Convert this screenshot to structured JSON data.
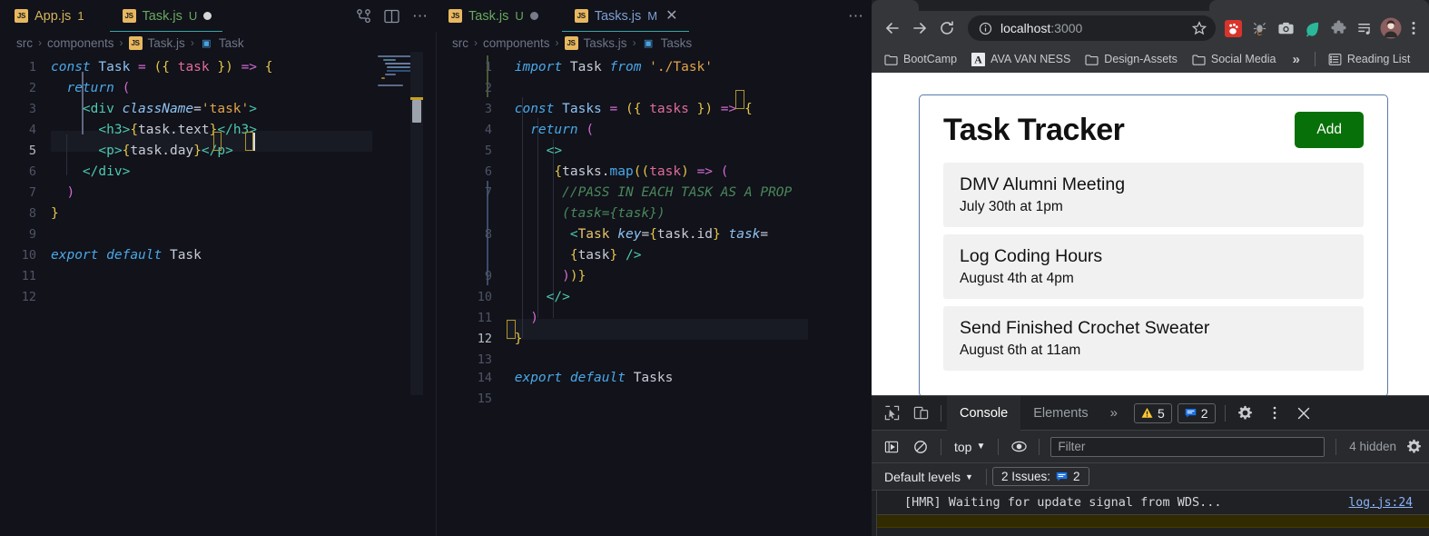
{
  "editor": {
    "pane_a": {
      "tabs": [
        {
          "label": "App.js",
          "icon": "js-file-icon",
          "badge": "1",
          "state": "",
          "active": false
        },
        {
          "label": "Task.js",
          "icon": "js-file-icon",
          "badge": "U",
          "state": "unsaved-dot",
          "active": true
        }
      ],
      "actions": [
        "source-control-icon",
        "split-editor-icon",
        "more-actions-icon"
      ],
      "breadcrumb": [
        "src",
        "components",
        "Task.js",
        "Task"
      ],
      "lines": [
        {
          "n": "1",
          "text": "const Task = ({ task }) => {"
        },
        {
          "n": "2",
          "text": "  return ("
        },
        {
          "n": "3",
          "text": "    <div className='task'>"
        },
        {
          "n": "4",
          "text": "      <h3>{task.text}</h3>"
        },
        {
          "n": "5",
          "text": "      <p>{task.day}</p>"
        },
        {
          "n": "6",
          "text": "    </div>"
        },
        {
          "n": "7",
          "text": "  )"
        },
        {
          "n": "8",
          "text": "}"
        },
        {
          "n": "9",
          "text": ""
        },
        {
          "n": "10",
          "text": "export default Task"
        },
        {
          "n": "11",
          "text": ""
        },
        {
          "n": "12",
          "text": ""
        }
      ],
      "cursor_line": "5"
    },
    "pane_b": {
      "tabs": [
        {
          "label": "Task.js",
          "icon": "js-file-icon",
          "badge": "U",
          "state": "unsaved-dot",
          "active": false
        },
        {
          "label": "Tasks.js",
          "icon": "js-file-icon",
          "badge": "M",
          "state": "close-icon",
          "active": true
        }
      ],
      "actions": [
        "more-actions-icon"
      ],
      "breadcrumb": [
        "src",
        "components",
        "Tasks.js",
        "Tasks"
      ],
      "lines": [
        {
          "n": "1",
          "text": "import Task from './Task'"
        },
        {
          "n": "2",
          "text": ""
        },
        {
          "n": "3",
          "text": "const Tasks = ({ tasks }) => {"
        },
        {
          "n": "4",
          "text": "  return ("
        },
        {
          "n": "5",
          "text": "    <>"
        },
        {
          "n": "6",
          "text": "     {tasks.map((task) => ("
        },
        {
          "n": "7",
          "text": "       //PASS IN EACH TASK AS A PROP (task={task})"
        },
        {
          "n": "8",
          "text": "        <Task key={task.id} task={task} />"
        },
        {
          "n": "9",
          "text": "      ))}"
        },
        {
          "n": "10",
          "text": "    </>"
        },
        {
          "n": "11",
          "text": "  )"
        },
        {
          "n": "12",
          "text": "}"
        },
        {
          "n": "13",
          "text": ""
        },
        {
          "n": "14",
          "text": "export default Tasks"
        },
        {
          "n": "15",
          "text": ""
        }
      ],
      "cursor_line": "12"
    }
  },
  "browser": {
    "nav": {
      "back": "back-arrow-icon",
      "forward": "forward-arrow-icon",
      "reload": "reload-icon"
    },
    "omnibox": {
      "info_icon": "site-info-icon",
      "url_host": "localhost",
      "url_port": ":3000",
      "bookmark_icon": "star-icon"
    },
    "extensions": [
      "red-paw-extension-icon",
      "bug-c-extension-icon",
      "camera-extension-icon",
      "leaf-extension-icon",
      "puzzle-extensions-icon",
      "reading-list-icon"
    ],
    "profile": "profile-avatar",
    "menu": "chrome-menu-icon",
    "bookmarks": [
      {
        "label": "BootCamp",
        "icon": "folder-icon"
      },
      {
        "label": "AVA VAN NESS",
        "icon": "a-logo-icon"
      },
      {
        "label": "Design-Assets",
        "icon": "folder-icon"
      },
      {
        "label": "Social Media",
        "icon": "folder-icon"
      }
    ],
    "bookmarks_overflow": "»",
    "reading_list": {
      "label": "Reading List",
      "icon": "reading-list-icon"
    }
  },
  "app": {
    "title": "Task Tracker",
    "add_button": "Add",
    "tasks": [
      {
        "text": "DMV Alumni Meeting",
        "day": "July 30th at 1pm"
      },
      {
        "text": "Log Coding Hours",
        "day": "August 4th at 4pm"
      },
      {
        "text": "Send Finished Crochet Sweater",
        "day": "August 6th at 11am"
      }
    ]
  },
  "devtools": {
    "inspect_icon": "inspect-element-icon",
    "device_icon": "device-toolbar-icon",
    "tabs": [
      {
        "label": "Console",
        "active": true
      },
      {
        "label": "Elements",
        "active": false
      }
    ],
    "more_tabs": "»",
    "warnings_count": "5",
    "issues_count": "2",
    "settings_icon": "gear-icon",
    "more_icon": "devtools-more-icon",
    "close_icon": "close-icon",
    "console": {
      "sidebar_icon": "console-sidebar-icon",
      "clear_icon": "clear-console-icon",
      "context": "top",
      "eye_icon": "live-expression-icon",
      "filter_placeholder": "Filter",
      "hidden_text": "4 hidden",
      "settings_icon": "gear-icon",
      "levels": "Default levels",
      "issues_label": "2 Issues:",
      "issues_badge": "2",
      "messages": [
        {
          "text": "[HMR] Waiting for update signal from WDS...",
          "source": "log.js:24"
        }
      ]
    }
  },
  "colors": {
    "accent_green": "#087008",
    "editor_bg": "#11121a",
    "chrome_bg": "#35363a",
    "devtools_bg": "#202124"
  }
}
